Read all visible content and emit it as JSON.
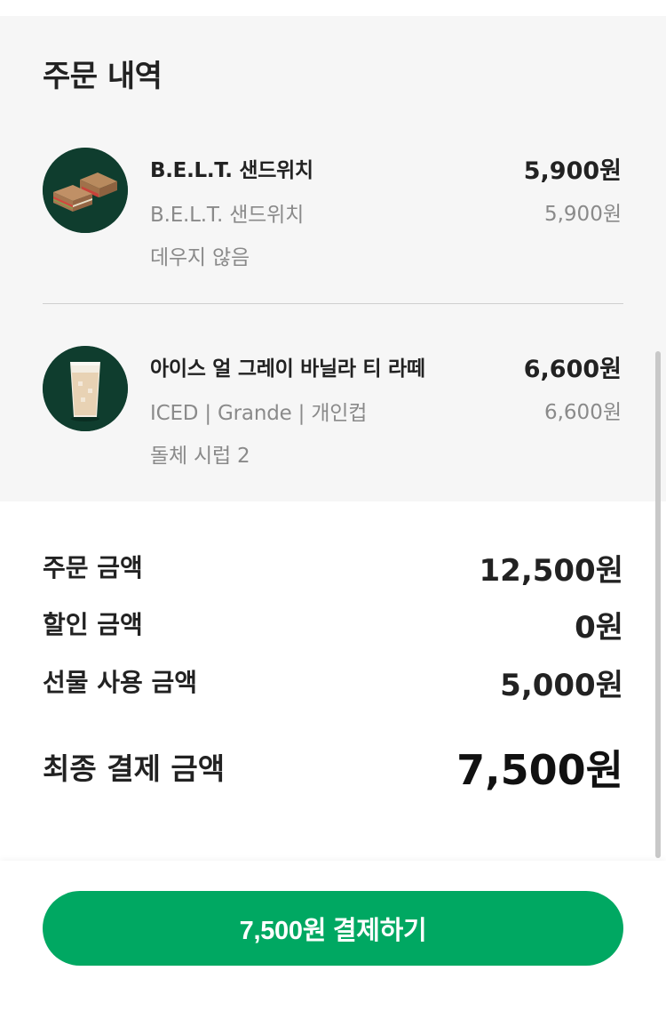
{
  "colors": {
    "accent": "#00a862",
    "section_bg": "#f6f6f6",
    "thumb_bg": "#0f3d2e"
  },
  "order": {
    "title": "주문 내역",
    "items": [
      {
        "icon": "sandwich-icon",
        "name": "B.E.L.T. 샌드위치",
        "price": "5,900원",
        "sub": "B.E.L.T. 샌드위치",
        "sub_price": "5,900원",
        "option": "데우지 않음"
      },
      {
        "icon": "iced-latte-icon",
        "name": "아이스 얼 그레이 바닐라 티 라떼",
        "price": "6,600원",
        "sub": "ICED | Grande | 개인컵",
        "sub_price": "6,600원",
        "option": "돌체 시럽 2"
      }
    ]
  },
  "summary": {
    "order_amount_label": "주문 금액",
    "order_amount_value": "12,500원",
    "discount_label": "할인 금액",
    "discount_value": "0원",
    "gift_label": "선물 사용 금액",
    "gift_value": "5,000원",
    "final_label": "최종 결제 금액",
    "final_value": "7,500원"
  },
  "pay_button": {
    "label": "7,500원 결제하기"
  }
}
